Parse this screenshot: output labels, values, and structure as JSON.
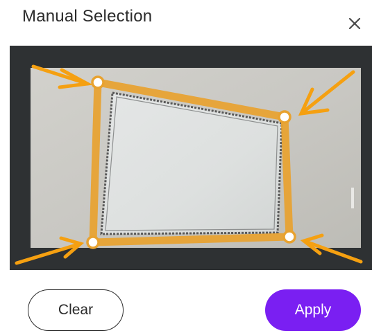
{
  "dialog": {
    "title": "Manual Selection",
    "close_icon": "close-icon"
  },
  "preview": {
    "handle_icon": "corner-handle-icon",
    "arrow_icon": "arrow-icon"
  },
  "actions": {
    "clear_label": "Clear",
    "apply_label": "Apply"
  },
  "colors": {
    "accent": "#7a1ff2",
    "selection": "#e8a22f",
    "arrow": "#f5a011",
    "backdrop": "#2e3133"
  }
}
